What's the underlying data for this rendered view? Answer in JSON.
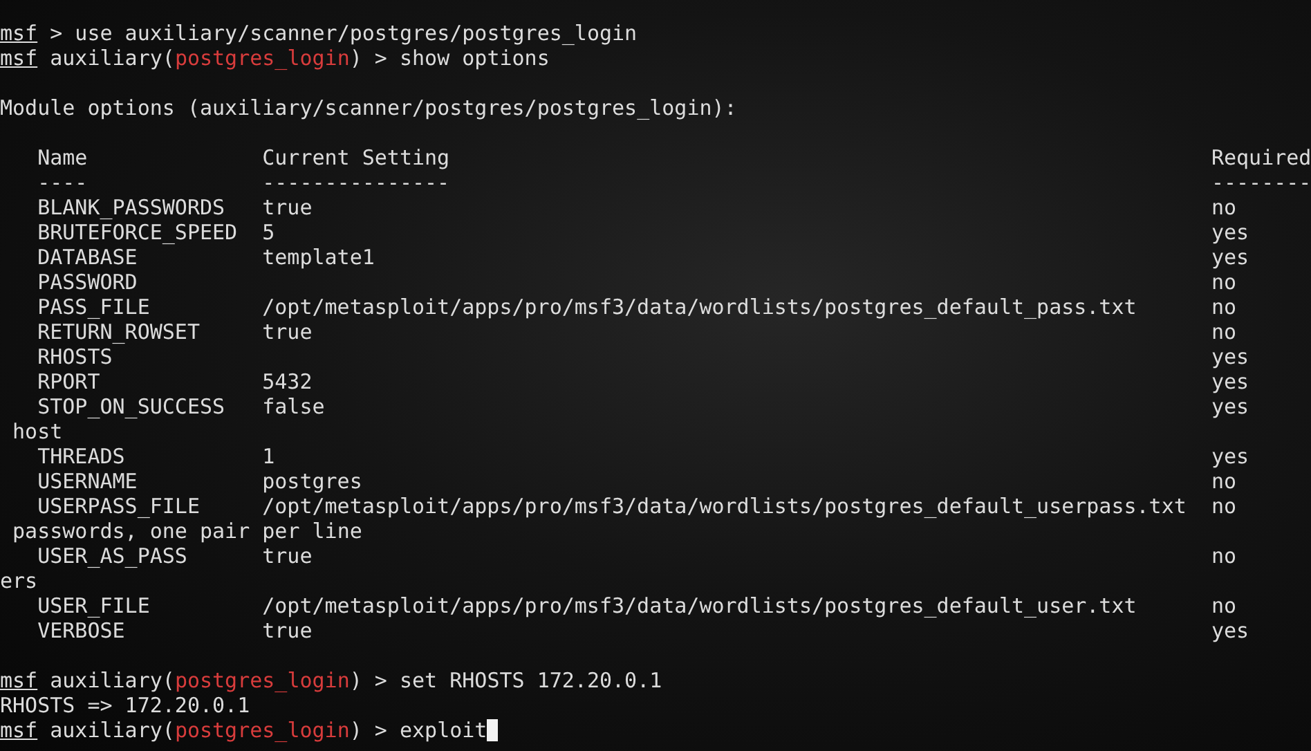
{
  "terminal": {
    "lines": [
      {
        "kind": "prompt",
        "prompt": "msf",
        "after": " > use auxiliary/scanner/postgres/postgres_login"
      },
      {
        "kind": "prompt",
        "prompt": "msf",
        "before": " auxiliary(",
        "module": "postgres_login",
        "after": ") > show options"
      },
      {
        "kind": "blank"
      },
      {
        "kind": "text",
        "text": "Module options (auxiliary/scanner/postgres/postgres_login):"
      },
      {
        "kind": "blank"
      },
      {
        "kind": "header",
        "name": "Name",
        "setting": "Current Setting",
        "required": "Required"
      },
      {
        "kind": "header",
        "name": "----",
        "setting": "---------------",
        "required": "--------"
      },
      {
        "kind": "option",
        "name": "BLANK_PASSWORDS",
        "setting": "true",
        "required": "no"
      },
      {
        "kind": "option",
        "name": "BRUTEFORCE_SPEED",
        "setting": "5",
        "required": "yes"
      },
      {
        "kind": "option",
        "name": "DATABASE",
        "setting": "template1",
        "required": "yes"
      },
      {
        "kind": "option",
        "name": "PASSWORD",
        "required": "no"
      },
      {
        "kind": "option",
        "name": "PASS_FILE",
        "setting": "/opt/metasploit/apps/pro/msf3/data/wordlists/postgres_default_pass.txt",
        "required": "no"
      },
      {
        "kind": "option",
        "name": "RETURN_ROWSET",
        "setting": "true",
        "required": "no"
      },
      {
        "kind": "option",
        "name": "RHOSTS",
        "required": "yes"
      },
      {
        "kind": "option",
        "name": "RPORT",
        "setting": "5432",
        "required": "yes"
      },
      {
        "kind": "option",
        "name": "STOP_ON_SUCCESS",
        "setting": "false",
        "required": "yes"
      },
      {
        "kind": "text",
        "text": " host"
      },
      {
        "kind": "option",
        "name": "THREADS",
        "setting": "1",
        "required": "yes"
      },
      {
        "kind": "option",
        "name": "USERNAME",
        "setting": "postgres",
        "required": "no"
      },
      {
        "kind": "option",
        "name": "USERPASS_FILE",
        "setting": "/opt/metasploit/apps/pro/msf3/data/wordlists/postgres_default_userpass.txt",
        "required": "no"
      },
      {
        "kind": "text",
        "text": " passwords, one pair per line"
      },
      {
        "kind": "option",
        "name": "USER_AS_PASS",
        "setting": "true",
        "required": "no"
      },
      {
        "kind": "text",
        "text": "ers"
      },
      {
        "kind": "option",
        "name": "USER_FILE",
        "setting": "/opt/metasploit/apps/pro/msf3/data/wordlists/postgres_default_user.txt",
        "required": "no"
      },
      {
        "kind": "option",
        "name": "VERBOSE",
        "setting": "true",
        "required": "yes"
      },
      {
        "kind": "blank"
      },
      {
        "kind": "prompt",
        "prompt": "msf",
        "before": " auxiliary(",
        "module": "postgres_login",
        "after": ") > set RHOSTS 172.20.0.1"
      },
      {
        "kind": "text",
        "text": "RHOSTS => 172.20.0.1"
      },
      {
        "kind": "prompt",
        "cursor": true,
        "prompt": "msf",
        "before": " auxiliary(",
        "module": "postgres_login",
        "after": ") > exploit"
      }
    ]
  }
}
